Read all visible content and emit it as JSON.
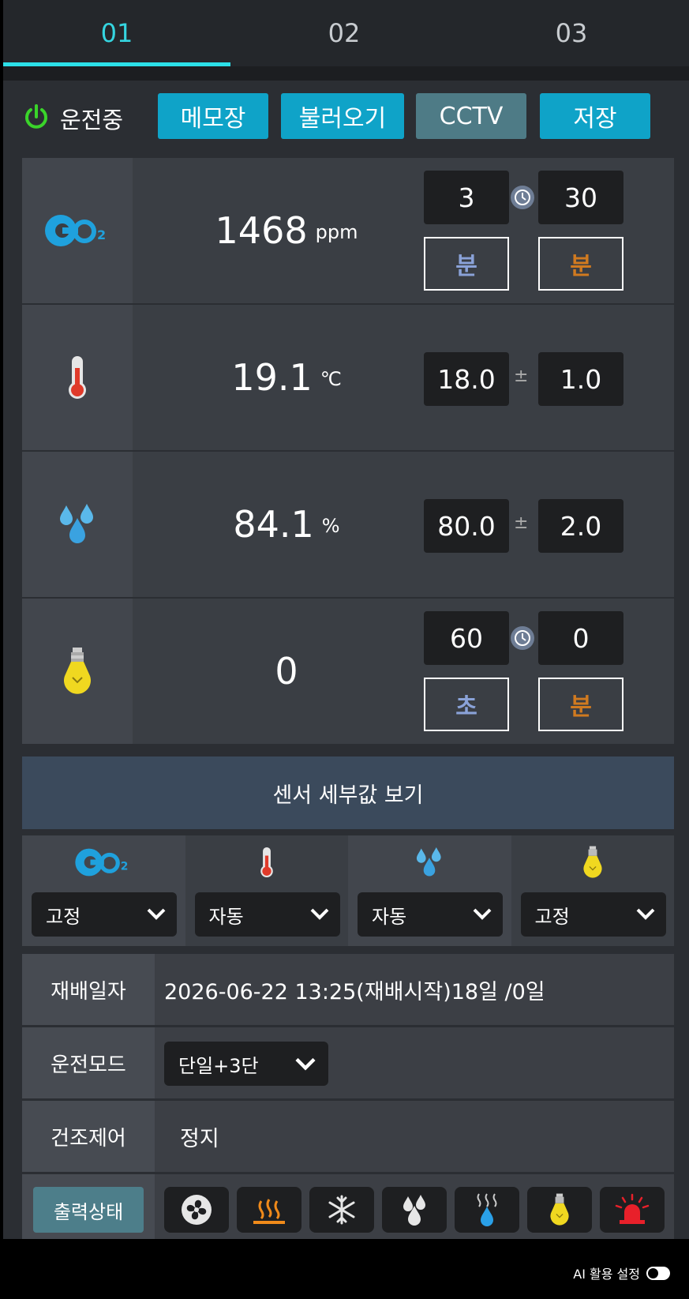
{
  "tabs": [
    {
      "label": "01"
    },
    {
      "label": "02"
    },
    {
      "label": "03"
    }
  ],
  "status": {
    "label": "운전중",
    "color": "#3ad42a"
  },
  "toolbar": {
    "memo": "메모장",
    "load": "불러오기",
    "cctv": "CCTV",
    "save": "저장"
  },
  "sensors": {
    "co2": {
      "value": "1468",
      "unit": "ppm",
      "left_value": "3",
      "right_value": "30",
      "left_unit": "분",
      "right_unit": "분"
    },
    "temperature": {
      "value": "19.1",
      "unit": "℃",
      "target": "18.0",
      "sep": "±",
      "tolerance": "1.0"
    },
    "humidity": {
      "value": "84.1",
      "unit": "%",
      "target": "80.0",
      "sep": "±",
      "tolerance": "2.0"
    },
    "light": {
      "value": "0",
      "left_value": "60",
      "right_value": "0",
      "left_unit": "초",
      "right_unit": "분"
    }
  },
  "detail_button": "센서 세부값 보기",
  "modes": {
    "co2": "고정",
    "temperature": "자동",
    "humidity": "자동",
    "light": "고정"
  },
  "info": {
    "cultivation_label": "재배일자",
    "cultivation_value": "2026-06-22 13:25(재배시작)18일 /0일",
    "run_mode_label": "운전모드",
    "run_mode_value": "단일+3단",
    "dry_label": "건조제어",
    "dry_value": "정지",
    "output_label": "출력상태"
  },
  "outputs": [
    "fan-icon",
    "heater-icon",
    "cooler-icon",
    "dehumidifier-icon",
    "humidifier-icon",
    "light-bulb-icon",
    "alarm-icon"
  ],
  "footer": {
    "ai_label": "AI 활용 설정",
    "ai_toggle": "off"
  },
  "colors": {
    "accent": "#0fa3c8",
    "tab_active": "#2ce0e8",
    "orange": "#d07a20",
    "blue_unit": "#8aa2d8"
  }
}
